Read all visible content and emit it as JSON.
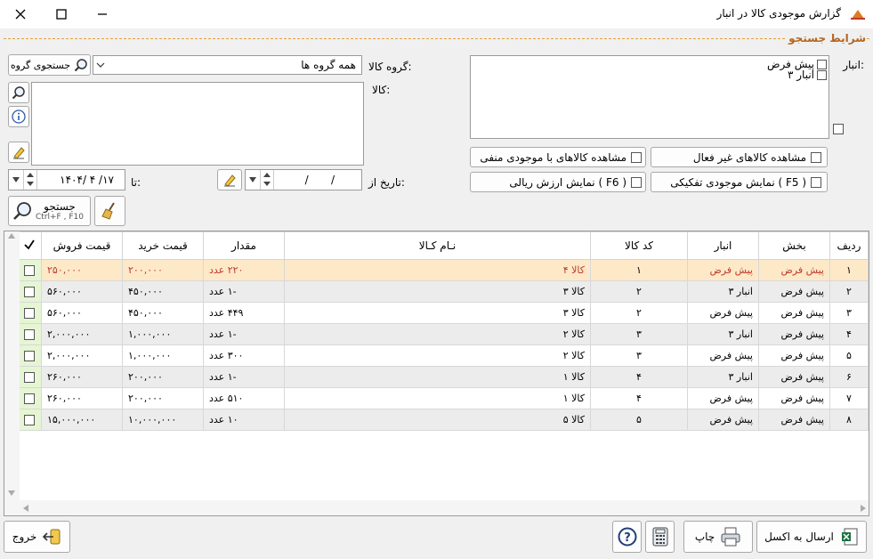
{
  "window": {
    "title": "گزارش موجودی کالا در انبار"
  },
  "section_title": "شرایط جستجو",
  "warehouse": {
    "label": "انبار:",
    "items": [
      "پیش فرض",
      "انبار ۳"
    ]
  },
  "group": {
    "label": "گروه کالا:",
    "selected": "همه گروه ها",
    "search_button": "جستجوی گروه"
  },
  "goods": {
    "label": "کالا:"
  },
  "options": {
    "show_inactive": "مشاهده کالاهای غیر فعال",
    "show_negative": "مشاهده کالاهای با موجودی منفی",
    "show_detailed": "نمایش موجودی تفکیکی ( F5 )",
    "show_rial": "نمایش ارزش ریالی ( F6 )"
  },
  "dates": {
    "from_label": "تاریخ از:",
    "from_value": "/    /",
    "to_label": "تا:",
    "to_value": "۱۴۰۴/ ۴ /۱۷"
  },
  "search": {
    "label": "جستجو",
    "shortcut": "Ctrl+F , F10"
  },
  "table": {
    "columns": [
      "ردیف",
      "بخش",
      "انبار",
      "کد کالا",
      "نـام کـالا",
      "مقدار",
      "قیمت خرید",
      "قیمت فروش"
    ],
    "rows": [
      {
        "n": "۱",
        "section": "پیش فرض",
        "store": "پیش فرض",
        "code": "۱",
        "name": "کالا ۴",
        "qty": "۲۲۰ عدد",
        "buy": "۲۰۰,۰۰۰",
        "sell": "۲۵۰,۰۰۰"
      },
      {
        "n": "۲",
        "section": "پیش فرض",
        "store": "انبار ۳",
        "code": "۲",
        "name": "کالا ۳",
        "qty": "-۱ عدد",
        "buy": "۴۵۰,۰۰۰",
        "sell": "۵۶۰,۰۰۰"
      },
      {
        "n": "۳",
        "section": "پیش فرض",
        "store": "پیش فرض",
        "code": "۲",
        "name": "کالا ۳",
        "qty": "۴۴۹ عدد",
        "buy": "۴۵۰,۰۰۰",
        "sell": "۵۶۰,۰۰۰"
      },
      {
        "n": "۴",
        "section": "پیش فرض",
        "store": "انبار ۳",
        "code": "۳",
        "name": "کالا ۲",
        "qty": "-۱ عدد",
        "buy": "۱,۰۰۰,۰۰۰",
        "sell": "۲,۰۰۰,۰۰۰"
      },
      {
        "n": "۵",
        "section": "پیش فرض",
        "store": "پیش فرض",
        "code": "۳",
        "name": "کالا ۲",
        "qty": "۳۰۰ عدد",
        "buy": "۱,۰۰۰,۰۰۰",
        "sell": "۲,۰۰۰,۰۰۰"
      },
      {
        "n": "۶",
        "section": "پیش فرض",
        "store": "انبار ۳",
        "code": "۴",
        "name": "کالا ۱",
        "qty": "-۱ عدد",
        "buy": "۲۰۰,۰۰۰",
        "sell": "۲۶۰,۰۰۰"
      },
      {
        "n": "۷",
        "section": "پیش فرض",
        "store": "پیش فرض",
        "code": "۴",
        "name": "کالا ۱",
        "qty": "۵۱۰ عدد",
        "buy": "۲۰۰,۰۰۰",
        "sell": "۲۶۰,۰۰۰"
      },
      {
        "n": "۸",
        "section": "پیش فرض",
        "store": "پیش فرض",
        "code": "۵",
        "name": "کالا ۵",
        "qty": "۱۰ عدد",
        "buy": "۱۰,۰۰۰,۰۰۰",
        "sell": "۱۵,۰۰۰,۰۰۰"
      }
    ]
  },
  "bottom": {
    "exit": "خروج",
    "print": "چاپ",
    "excel": "ارسال به اکسل"
  },
  "colors": {
    "accent": "#b5651d",
    "selected_row": "#fde9c8",
    "check_col": "#e6f5d4"
  }
}
